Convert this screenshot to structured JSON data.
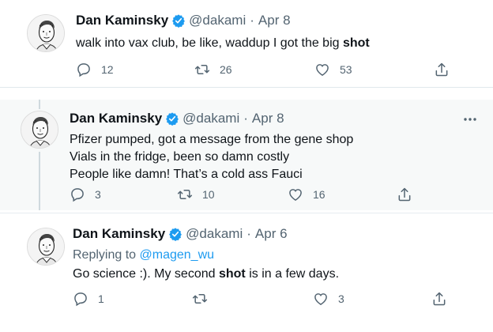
{
  "tweets": [
    {
      "name": "Dan Kaminsky",
      "handle": "@dakami",
      "separator": "·",
      "date": "Apr 8",
      "text_before": "walk into vax club, be like, waddup I got the big ",
      "text_bold": "shot",
      "text_after": "",
      "reply_count": "12",
      "retweet_count": "26",
      "like_count": "53"
    },
    {
      "name": "Dan Kaminsky",
      "handle": "@dakami",
      "separator": "·",
      "date": "Apr 8",
      "lines": [
        "Pfizer pumped, got a message from the gene shop",
        "Vials in the fridge, been so damn costly",
        "People like damn!  That’s a cold ass Fauci"
      ],
      "reply_count": "3",
      "retweet_count": "10",
      "like_count": "16"
    },
    {
      "name": "Dan Kaminsky",
      "handle": "@dakami",
      "separator": "·",
      "date": "Apr 6",
      "replying_label": "Replying to ",
      "replying_mention": "@magen_wu",
      "text_before": "Go science :). My second ",
      "text_bold": "shot",
      "text_after": " is in a few days.",
      "reply_count": "1",
      "retweet_count": "",
      "like_count": "3"
    }
  ],
  "colors": {
    "verified": "#1d9bf0",
    "muted": "#536471",
    "link": "#1d9bf0",
    "highlight_bg": "#f7f9f9"
  },
  "icons": {
    "reply": "reply-icon",
    "retweet": "retweet-icon",
    "like": "heart-icon",
    "share": "share-icon",
    "verified": "verified-badge-icon",
    "more": "more-icon"
  }
}
